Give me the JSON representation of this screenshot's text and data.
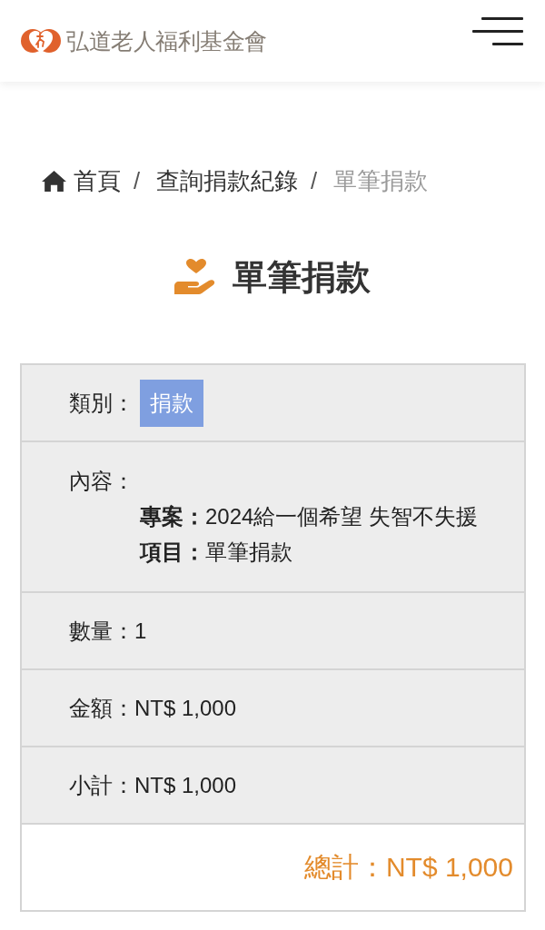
{
  "header": {
    "org_name": "弘道老人福利基金會"
  },
  "breadcrumb": [
    {
      "label": "首頁",
      "active": false
    },
    {
      "label": "查詢捐款紀錄",
      "active": false,
      "separator": "/"
    },
    {
      "label": "單筆捐款",
      "active": true,
      "separator": "/"
    }
  ],
  "page_title": "單筆捐款",
  "details": {
    "rows": [
      {
        "kind": "badge",
        "label": "類別：",
        "value": "捐款"
      },
      {
        "kind": "content",
        "label": "內容：",
        "lines": [
          {
            "label": "專案：",
            "value": "2024給一個希望 失智不失援"
          },
          {
            "label": "項目：",
            "value": "單筆捐款"
          }
        ]
      },
      {
        "kind": "text",
        "label": "數量：",
        "value": "1"
      },
      {
        "kind": "text",
        "label": "金額：",
        "value": "NT$ 1,000"
      },
      {
        "kind": "text",
        "label": "小計：",
        "value": "NT$ 1,000"
      }
    ],
    "total": {
      "label": "總計：",
      "value": "NT$ 1,000"
    }
  }
}
